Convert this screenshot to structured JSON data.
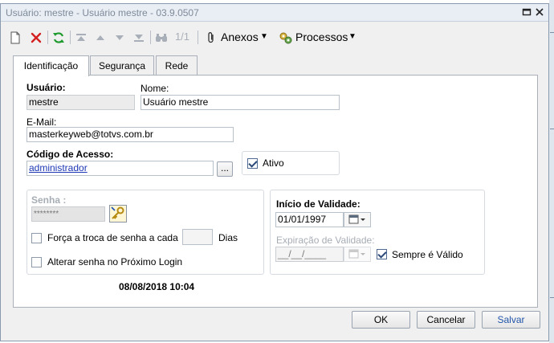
{
  "window": {
    "title": "Usuário: mestre - Usuário mestre - 03.9.0507"
  },
  "toolbar": {
    "record_position": "1/1",
    "attachments_label": "Anexos",
    "processes_label": "Processos"
  },
  "tabs": [
    {
      "label": "Identificação",
      "active": true
    },
    {
      "label": "Segurança",
      "active": false
    },
    {
      "label": "Rede",
      "active": false
    }
  ],
  "form": {
    "usuario_label": "Usuário:",
    "usuario_value": "mestre",
    "nome_label": "Nome:",
    "nome_value": "Usuário mestre",
    "email_label": "E-Mail:",
    "email_value": "masterkeyweb@totvs.com.br",
    "codigo_label": "Código de Acesso:",
    "codigo_value": "administrador",
    "lookup_button": "...",
    "ativo_label": "Ativo",
    "ativo_checked": true
  },
  "senha": {
    "label": "Senha :",
    "value": "********",
    "force_change_label": "Força a troca de senha a cada",
    "force_change_checked": false,
    "days_value": "",
    "days_label": "Dias",
    "change_next_login_label": "Alterar senha no Próximo Login",
    "change_next_login_checked": false
  },
  "validade": {
    "inicio_label": "Início de Validade:",
    "inicio_value": "01/01/1997",
    "expiracao_label": "Expiração de Validade:",
    "expiracao_value": "__/__/____",
    "sempre_valido_label": "Sempre é Válido",
    "sempre_valido_checked": true
  },
  "timestamp": "08/08/2018 10:04",
  "buttons": {
    "ok": "OK",
    "cancel": "Cancelar",
    "save": "Salvar"
  },
  "colors": {
    "accent_link": "#1c36b5",
    "save_text": "#2255aa",
    "delete_icon": "#d42020",
    "refresh_icon": "#1e9a2e"
  }
}
